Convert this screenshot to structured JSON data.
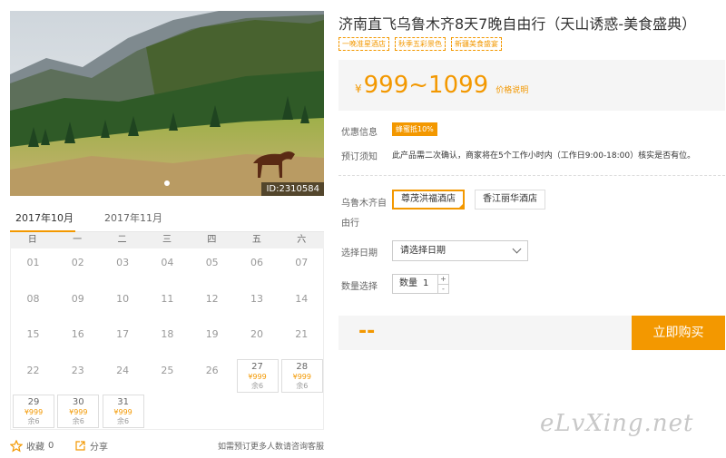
{
  "photo": {
    "id_label": "ID:2310584"
  },
  "calendar": {
    "tabs": [
      "2017年10月",
      "2017年11月"
    ],
    "weekdays": [
      "日",
      "一",
      "二",
      "三",
      "四",
      "五",
      "六"
    ],
    "days": [
      {
        "day": "01"
      },
      {
        "day": "02"
      },
      {
        "day": "03"
      },
      {
        "day": "04"
      },
      {
        "day": "05"
      },
      {
        "day": "06"
      },
      {
        "day": "07"
      },
      {
        "day": "08"
      },
      {
        "day": "09"
      },
      {
        "day": "10"
      },
      {
        "day": "11"
      },
      {
        "day": "12"
      },
      {
        "day": "13"
      },
      {
        "day": "14"
      },
      {
        "day": "15"
      },
      {
        "day": "16"
      },
      {
        "day": "17"
      },
      {
        "day": "18"
      },
      {
        "day": "19"
      },
      {
        "day": "20"
      },
      {
        "day": "21"
      },
      {
        "day": "22"
      },
      {
        "day": "23"
      },
      {
        "day": "24"
      },
      {
        "day": "25"
      },
      {
        "day": "26"
      },
      {
        "day": "27",
        "price": "¥999",
        "stock": "余6"
      },
      {
        "day": "28",
        "price": "¥999",
        "stock": "余6"
      },
      {
        "day": "29",
        "price": "¥999",
        "stock": "余6"
      },
      {
        "day": "30",
        "price": "¥999",
        "stock": "余6"
      },
      {
        "day": "31",
        "price": "¥999",
        "stock": "余6"
      }
    ]
  },
  "footer": {
    "favorite_label": "收藏",
    "favorite_count": "0",
    "share_label": "分享",
    "contact_note": "如需预订更多人数请咨询客服"
  },
  "product": {
    "title": "济南直飞乌鲁木齐8天7晚自由行（天山诱惑-美食盛典）",
    "tags": [
      "一晚准星酒店",
      "秋季五彩景色",
      "新疆美食盛宴"
    ],
    "price": {
      "currency": "¥",
      "value": "999~1099",
      "note": "价格说明"
    },
    "discount_label": "优惠信息",
    "discount_badge": "蜂蜜抵10%",
    "notice_label": "预订须知",
    "notice_text": "此产品需二次确认，商家将在5个工作小时内（工作日9:00-18:00）核实是否有位。",
    "hotel_label": "乌鲁木齐自由行",
    "hotels": [
      {
        "name": "尊茂洪福酒店",
        "selected": true
      },
      {
        "name": "香江丽华酒店",
        "selected": false
      }
    ],
    "date_label": "选择日期",
    "date_placeholder": "请选择日期",
    "qty_label": "数量选择",
    "qty_text": "数量",
    "qty_value": "1",
    "qty_plus": "+",
    "qty_minus": "-",
    "total": "--",
    "buy_label": "立即购买"
  },
  "watermark": "eLvXing.net",
  "colors": {
    "accent": "#f39800"
  }
}
